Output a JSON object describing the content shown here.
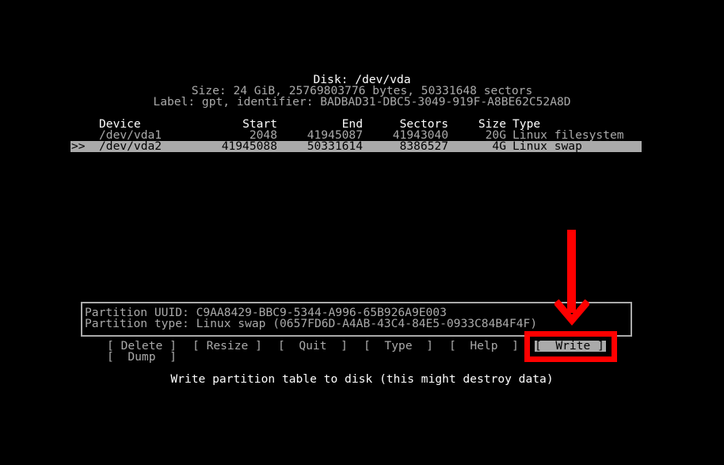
{
  "disk": {
    "title": "Disk: /dev/vda",
    "size_line": "Size: 24 GiB, 25769803776 bytes, 50331648 sectors",
    "label_line": "Label: gpt, identifier: BADBAD31-DBC5-3049-919F-A8BE62C52A8D"
  },
  "table": {
    "headers": {
      "device": "Device",
      "start": "Start",
      "end": "End",
      "sectors": "Sectors",
      "size": "Size",
      "type": "Type"
    },
    "rows": [
      {
        "marker": "",
        "device": "/dev/vda1",
        "start": "2048",
        "end": "41945087",
        "sectors": "41943040",
        "size": "20G",
        "type": "Linux filesystem",
        "selected": false
      },
      {
        "marker": ">>",
        "device": "/dev/vda2",
        "start": "41945088",
        "end": "50331614",
        "sectors": "8386527",
        "size": "4G",
        "type": "Linux swap",
        "selected": true
      }
    ]
  },
  "info": {
    "uuid_line": "Partition UUID: C9AA8429-BBC9-5344-A996-65B926A9E003",
    "type_line": "Partition type: Linux swap (0657FD6D-A4AB-43C4-84E5-0933C84B4F4F)"
  },
  "menu": {
    "buttons": [
      {
        "id": "delete",
        "label": "[ Delete ]"
      },
      {
        "id": "resize",
        "label": "[ Resize ]"
      },
      {
        "id": "quit",
        "label": "[  Quit  ]"
      },
      {
        "id": "type",
        "label": "[  Type  ]"
      },
      {
        "id": "help",
        "label": "[  Help  ]"
      },
      {
        "id": "write",
        "label": "[  Write ]",
        "selected": true
      },
      {
        "id": "dump",
        "label": "[  Dump  ]"
      }
    ],
    "hint": "Write partition table to disk (this might destroy data)"
  },
  "annotation": {
    "color": "#ff0000",
    "target": "write-button"
  }
}
